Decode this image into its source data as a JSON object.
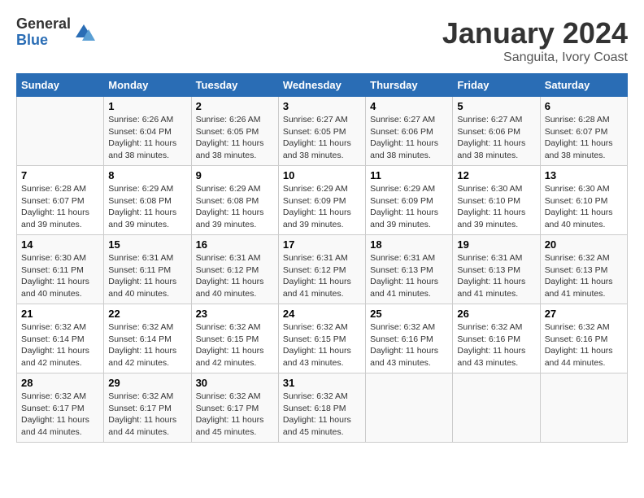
{
  "logo": {
    "general": "General",
    "blue": "Blue"
  },
  "title": "January 2024",
  "location": "Sanguita, Ivory Coast",
  "days_header": [
    "Sunday",
    "Monday",
    "Tuesday",
    "Wednesday",
    "Thursday",
    "Friday",
    "Saturday"
  ],
  "weeks": [
    [
      {
        "day": "",
        "info": ""
      },
      {
        "day": "1",
        "info": "Sunrise: 6:26 AM\nSunset: 6:04 PM\nDaylight: 11 hours and 38 minutes."
      },
      {
        "day": "2",
        "info": "Sunrise: 6:26 AM\nSunset: 6:05 PM\nDaylight: 11 hours and 38 minutes."
      },
      {
        "day": "3",
        "info": "Sunrise: 6:27 AM\nSunset: 6:05 PM\nDaylight: 11 hours and 38 minutes."
      },
      {
        "day": "4",
        "info": "Sunrise: 6:27 AM\nSunset: 6:06 PM\nDaylight: 11 hours and 38 minutes."
      },
      {
        "day": "5",
        "info": "Sunrise: 6:27 AM\nSunset: 6:06 PM\nDaylight: 11 hours and 38 minutes."
      },
      {
        "day": "6",
        "info": "Sunrise: 6:28 AM\nSunset: 6:07 PM\nDaylight: 11 hours and 38 minutes."
      }
    ],
    [
      {
        "day": "7",
        "info": "Sunrise: 6:28 AM\nSunset: 6:07 PM\nDaylight: 11 hours and 39 minutes."
      },
      {
        "day": "8",
        "info": "Sunrise: 6:29 AM\nSunset: 6:08 PM\nDaylight: 11 hours and 39 minutes."
      },
      {
        "day": "9",
        "info": "Sunrise: 6:29 AM\nSunset: 6:08 PM\nDaylight: 11 hours and 39 minutes."
      },
      {
        "day": "10",
        "info": "Sunrise: 6:29 AM\nSunset: 6:09 PM\nDaylight: 11 hours and 39 minutes."
      },
      {
        "day": "11",
        "info": "Sunrise: 6:29 AM\nSunset: 6:09 PM\nDaylight: 11 hours and 39 minutes."
      },
      {
        "day": "12",
        "info": "Sunrise: 6:30 AM\nSunset: 6:10 PM\nDaylight: 11 hours and 39 minutes."
      },
      {
        "day": "13",
        "info": "Sunrise: 6:30 AM\nSunset: 6:10 PM\nDaylight: 11 hours and 40 minutes."
      }
    ],
    [
      {
        "day": "14",
        "info": "Sunrise: 6:30 AM\nSunset: 6:11 PM\nDaylight: 11 hours and 40 minutes."
      },
      {
        "day": "15",
        "info": "Sunrise: 6:31 AM\nSunset: 6:11 PM\nDaylight: 11 hours and 40 minutes."
      },
      {
        "day": "16",
        "info": "Sunrise: 6:31 AM\nSunset: 6:12 PM\nDaylight: 11 hours and 40 minutes."
      },
      {
        "day": "17",
        "info": "Sunrise: 6:31 AM\nSunset: 6:12 PM\nDaylight: 11 hours and 41 minutes."
      },
      {
        "day": "18",
        "info": "Sunrise: 6:31 AM\nSunset: 6:13 PM\nDaylight: 11 hours and 41 minutes."
      },
      {
        "day": "19",
        "info": "Sunrise: 6:31 AM\nSunset: 6:13 PM\nDaylight: 11 hours and 41 minutes."
      },
      {
        "day": "20",
        "info": "Sunrise: 6:32 AM\nSunset: 6:13 PM\nDaylight: 11 hours and 41 minutes."
      }
    ],
    [
      {
        "day": "21",
        "info": "Sunrise: 6:32 AM\nSunset: 6:14 PM\nDaylight: 11 hours and 42 minutes."
      },
      {
        "day": "22",
        "info": "Sunrise: 6:32 AM\nSunset: 6:14 PM\nDaylight: 11 hours and 42 minutes."
      },
      {
        "day": "23",
        "info": "Sunrise: 6:32 AM\nSunset: 6:15 PM\nDaylight: 11 hours and 42 minutes."
      },
      {
        "day": "24",
        "info": "Sunrise: 6:32 AM\nSunset: 6:15 PM\nDaylight: 11 hours and 43 minutes."
      },
      {
        "day": "25",
        "info": "Sunrise: 6:32 AM\nSunset: 6:16 PM\nDaylight: 11 hours and 43 minutes."
      },
      {
        "day": "26",
        "info": "Sunrise: 6:32 AM\nSunset: 6:16 PM\nDaylight: 11 hours and 43 minutes."
      },
      {
        "day": "27",
        "info": "Sunrise: 6:32 AM\nSunset: 6:16 PM\nDaylight: 11 hours and 44 minutes."
      }
    ],
    [
      {
        "day": "28",
        "info": "Sunrise: 6:32 AM\nSunset: 6:17 PM\nDaylight: 11 hours and 44 minutes."
      },
      {
        "day": "29",
        "info": "Sunrise: 6:32 AM\nSunset: 6:17 PM\nDaylight: 11 hours and 44 minutes."
      },
      {
        "day": "30",
        "info": "Sunrise: 6:32 AM\nSunset: 6:17 PM\nDaylight: 11 hours and 45 minutes."
      },
      {
        "day": "31",
        "info": "Sunrise: 6:32 AM\nSunset: 6:18 PM\nDaylight: 11 hours and 45 minutes."
      },
      {
        "day": "",
        "info": ""
      },
      {
        "day": "",
        "info": ""
      },
      {
        "day": "",
        "info": ""
      }
    ]
  ]
}
